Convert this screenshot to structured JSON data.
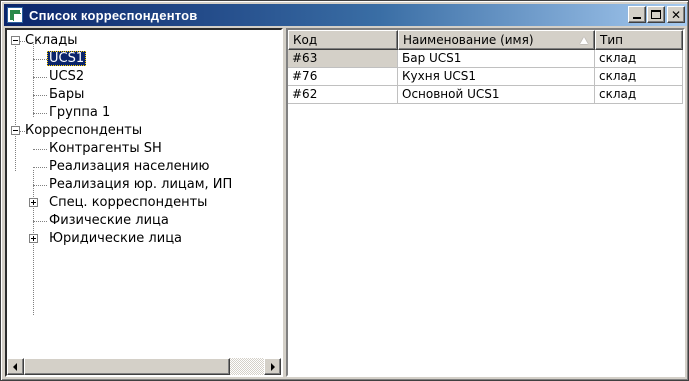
{
  "window": {
    "title": "Список корреспондентов",
    "icon": "correspondents-app-icon"
  },
  "tree": {
    "items": [
      {
        "label": "Склады",
        "expander": "minus"
      },
      {
        "label": "UCS1",
        "selected": true
      },
      {
        "label": "UCS2"
      },
      {
        "label": "Бары"
      },
      {
        "label": "Группа 1"
      },
      {
        "label": "Корреспонденты",
        "expander": "minus"
      },
      {
        "label": "Контрагенты SH"
      },
      {
        "label": "Реализация населению"
      },
      {
        "label": "Реализация юр. лицам, ИП"
      },
      {
        "label": "Спец. корреспонденты",
        "expander": "plus"
      },
      {
        "label": "Физические лица"
      },
      {
        "label": "Юридические лица",
        "expander": "plus"
      }
    ]
  },
  "grid": {
    "columns": [
      "Код",
      "Наименование (имя)",
      "Тип"
    ],
    "sorted_column": "Наименование (имя)",
    "rows": [
      [
        "#63",
        "Бар UCS1",
        "склад"
      ],
      [
        "#76",
        "Кухня UCS1",
        "склад"
      ],
      [
        "#62",
        "Основной UCS1",
        "склад"
      ]
    ]
  },
  "colors": {
    "titlebar_start": "#0a246a",
    "titlebar_end": "#a6caf0",
    "selection": "#0a246a",
    "face": "#d4d0c8"
  }
}
